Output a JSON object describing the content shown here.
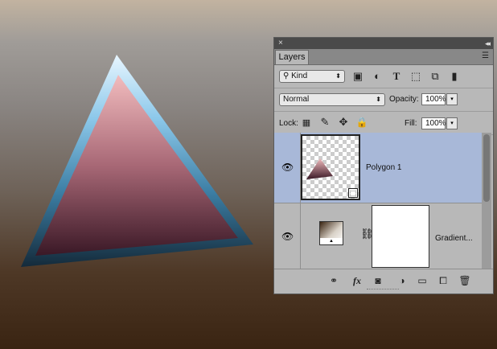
{
  "panel": {
    "close_glyph": "×",
    "collapse_glyph": "◂◂",
    "tab_label": "Layers",
    "menu_glyph": "☰"
  },
  "filter": {
    "kind_label": "Kind",
    "kind_glyph": "⚲",
    "icons": [
      "image-filter-icon",
      "adjustment-filter-icon",
      "type-filter-icon",
      "shape-filter-icon",
      "smart-object-filter-icon",
      "filter-toggle-icon"
    ]
  },
  "blend": {
    "mode_label": "Normal",
    "opacity_label": "Opacity:",
    "opacity_value": "100%"
  },
  "lock": {
    "lock_label": "Lock:",
    "fill_label": "Fill:",
    "fill_value": "100%"
  },
  "layers": [
    {
      "name": "Polygon 1",
      "selected": true,
      "visible": true
    },
    {
      "name": "Gradient...",
      "selected": false,
      "visible": true
    }
  ],
  "bottom_icons": [
    "link-layers-icon",
    "fx-icon",
    "add-mask-icon",
    "adjustment-layer-icon",
    "new-group-icon",
    "new-layer-icon",
    "trash-icon"
  ],
  "colors": {
    "selected_row": "#a8b8d8",
    "panel_bg": "#b8b8b8"
  }
}
